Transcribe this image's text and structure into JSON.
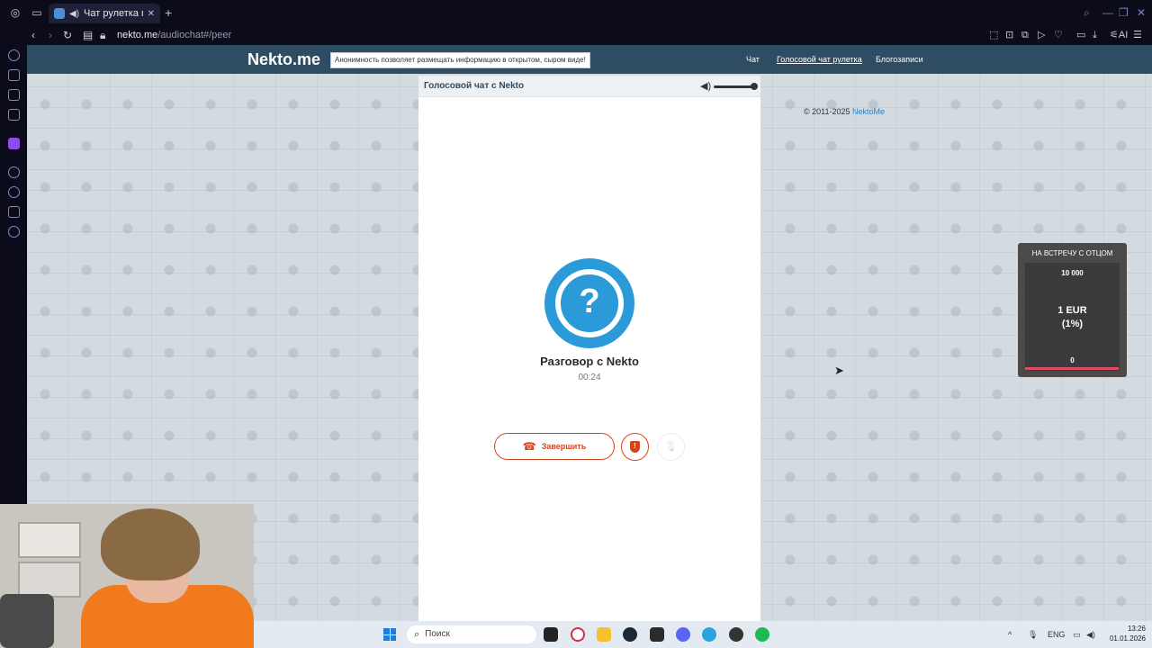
{
  "browser": {
    "tab": {
      "title": "Чат рулетка голосова"
    },
    "address": {
      "host": "nekto.me",
      "path": "/audiochat#/peer"
    }
  },
  "site": {
    "logo": "Nekto.me",
    "banner": "Анонимность позволяет размещать информацию в открытом, сыром виде!",
    "nav": [
      {
        "label": "Чат",
        "active": false
      },
      {
        "label": "Голосовой чат рулетка",
        "active": true
      },
      {
        "label": "Блогозаписи",
        "active": false
      }
    ]
  },
  "chat": {
    "title": "Голосовой чат с Nekto",
    "volume": 1.0,
    "avatar_symbol": "?",
    "peer_name": "Разговор с Nekto",
    "timer": "00:24",
    "end_button": "Завершить",
    "report_symbol": "!"
  },
  "copyright": {
    "text": "© 2011-2025",
    "link": "NektoMe"
  },
  "donation": {
    "title": "НА ВСТРЕЧУ С ОТЦОМ",
    "max": "10 000",
    "amount": "1 EUR",
    "percent": "(1%)",
    "min": "0",
    "progress": 0.01
  },
  "taskbar": {
    "search_placeholder": "Поиск",
    "lang": "ENG",
    "time": "13:26",
    "date": "01.01.2026"
  },
  "colors": {
    "header": "#2e4d63",
    "accent": "#2a9ad9",
    "danger": "#d2461f",
    "donation_bar": "#e04c64"
  }
}
